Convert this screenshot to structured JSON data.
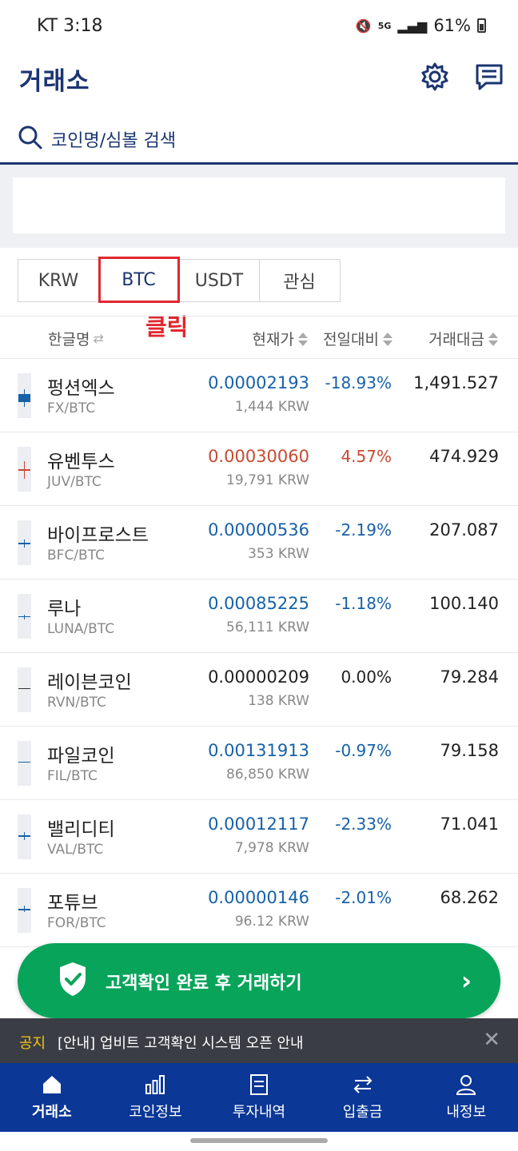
{
  "status_bar": {
    "carrier_time": "KT 3:18",
    "battery": "61%",
    "network": "5G"
  },
  "header": {
    "title": "거래소"
  },
  "search": {
    "placeholder": "코인명/심볼 검색"
  },
  "tabs": [
    {
      "label": "KRW",
      "active": false
    },
    {
      "label": "BTC",
      "active": true
    },
    {
      "label": "USDT",
      "active": false
    },
    {
      "label": "관심",
      "active": false
    }
  ],
  "annotation": "클릭",
  "table_header": {
    "name": "한글명",
    "price": "현재가",
    "change": "전일대비",
    "volume": "거래대금"
  },
  "coins": [
    {
      "name": "펑션엑스",
      "symbol": "FX/BTC",
      "price": "0.00002193",
      "krw": "1,444 KRW",
      "change": "-18.93%",
      "volume": "1,491.527",
      "direction": "down"
    },
    {
      "name": "유벤투스",
      "symbol": "JUV/BTC",
      "price": "0.00030060",
      "krw": "19,791 KRW",
      "change": "4.57%",
      "volume": "474.929",
      "direction": "up"
    },
    {
      "name": "바이프로스트",
      "symbol": "BFC/BTC",
      "price": "0.00000536",
      "krw": "353 KRW",
      "change": "-2.19%",
      "volume": "207.087",
      "direction": "down"
    },
    {
      "name": "루나",
      "symbol": "LUNA/BTC",
      "price": "0.00085225",
      "krw": "56,111 KRW",
      "change": "-1.18%",
      "volume": "100.140",
      "direction": "down"
    },
    {
      "name": "레이븐코인",
      "symbol": "RVN/BTC",
      "price": "0.00000209",
      "krw": "138 KRW",
      "change": "0.00%",
      "volume": "79.284",
      "direction": "flat"
    },
    {
      "name": "파일코인",
      "symbol": "FIL/BTC",
      "price": "0.00131913",
      "krw": "86,850 KRW",
      "change": "-0.97%",
      "volume": "79.158",
      "direction": "down"
    },
    {
      "name": "밸리디티",
      "symbol": "VAL/BTC",
      "price": "0.00012117",
      "krw": "7,978 KRW",
      "change": "-2.33%",
      "volume": "71.041",
      "direction": "down"
    },
    {
      "name": "포튜브",
      "symbol": "FOR/BTC",
      "price": "0.00000146",
      "krw": "96.12 KRW",
      "change": "-2.01%",
      "volume": "68.262",
      "direction": "down"
    }
  ],
  "kyc_button": {
    "label": "고객확인 완료 후 거래하기"
  },
  "notice": {
    "tag": "공지",
    "text": "[안내] 업비트 고객확인 시스템 오픈 안내"
  },
  "bottom_nav": [
    {
      "label": "거래소",
      "icon": "home-icon",
      "active": true
    },
    {
      "label": "코인정보",
      "icon": "bar-chart-icon",
      "active": false
    },
    {
      "label": "투자내역",
      "icon": "document-icon",
      "active": false
    },
    {
      "label": "입출금",
      "icon": "transfer-icon",
      "active": false
    },
    {
      "label": "내정보",
      "icon": "user-icon",
      "active": false
    }
  ],
  "colors": {
    "brand": "#1b3571",
    "up": "#c84a31",
    "down": "#1761a9",
    "highlight": "#e0282e",
    "kyc": "#07a45a",
    "nav": "#0b3796"
  }
}
